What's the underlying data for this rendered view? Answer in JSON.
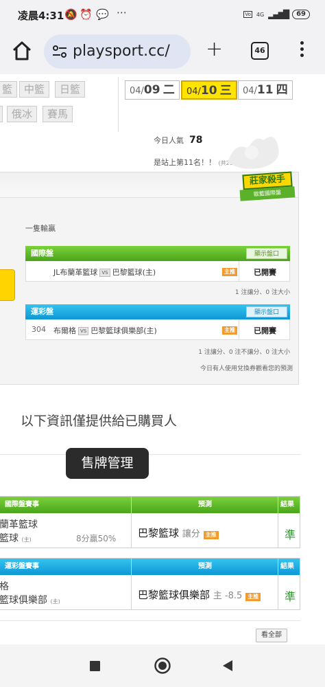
{
  "status_bar": {
    "time": "凌晨4:31",
    "signal_text": "4G",
    "battery": "69"
  },
  "browser": {
    "url": "playsport.cc/",
    "tab_count": "46"
  },
  "sport_tabs": [
    "籃",
    "中籃",
    "日籃",
    "俄冰",
    "賽馬"
  ],
  "dates": [
    {
      "month": "04/",
      "day": "09",
      "weekday": "二",
      "active": false
    },
    {
      "month": "04/",
      "day": "10",
      "weekday": "三",
      "active": true
    },
    {
      "month": "04/",
      "day": "11",
      "weekday": "四",
      "active": false
    }
  ],
  "popularity": {
    "label": "今日人氣",
    "value": "78",
    "rank_text": "是站上第11名！！",
    "total": "(共2165人)"
  },
  "badge": {
    "title": "莊家殺手",
    "subtitle": "歐籃國際盤"
  },
  "section_label": "一隻輸贏",
  "markets": [
    {
      "title": "國際盤",
      "show_button": "顯示盤口",
      "no": "",
      "away": "JL布蘭革籃球",
      "vs": "VS",
      "home": "巴黎籃球(主)",
      "zhu": "主推",
      "status": "已開賽",
      "note": "1 注讓分、0 注大小"
    },
    {
      "title": "運彩盤",
      "show_button": "顯示盤口",
      "no": "304",
      "away": "布爾格",
      "vs": "VS",
      "home": "巴黎籃球俱樂部(主)",
      "zhu": "主推",
      "status": "已開賽",
      "note": "1 注讓分、0 注不讓分、0 注大小"
    }
  ],
  "exchange_note": "今日有人使用兌換券觀看您的預測",
  "info_text": "以下資訊僅提供給已購買人",
  "toast": "售牌管理",
  "results": [
    {
      "head_game": "國際盤賽事",
      "head_pred": "預測",
      "head_result": "結果",
      "team1": "蘭革籃球",
      "team2": "籃球",
      "team2_sub": "(主)",
      "score": "8分贏50%",
      "prediction": "巴黎籃球",
      "pred_extra": "讓分",
      "zhu": "主推",
      "result": "準"
    },
    {
      "head_game": "運彩盤賽事",
      "head_pred": "預測",
      "head_result": "結果",
      "team1": "格",
      "team2": "籃球俱樂部",
      "team2_sub": "(主)",
      "score": "",
      "prediction": "巴黎籃球俱樂部",
      "pred_extra": "主 -8.5",
      "zhu": "主推",
      "result": "準"
    }
  ],
  "see_all": "看全部"
}
